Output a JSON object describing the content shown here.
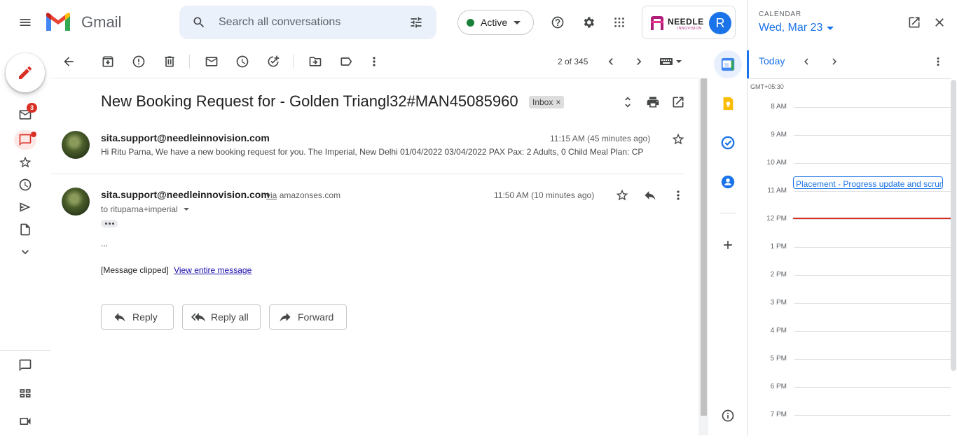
{
  "header": {
    "app_name": "Gmail",
    "search": {
      "placeholder": "Search all conversations"
    },
    "status_label": "Active",
    "brand_name": "NEEDLE",
    "brand_sub": "INNOVISION",
    "account_initial": "R"
  },
  "rail": {
    "mail_badge": "3"
  },
  "toolbar": {
    "pagination": "2 of 345"
  },
  "thread": {
    "subject": "New Booking Request for - Golden Triangl32#MAN45085960",
    "label": "Inbox",
    "messages": [
      {
        "sender": "sita.support@needleinnovision.com",
        "time": "11:15 AM (45 minutes ago)",
        "snippet": "Hi Ritu Parna, We have a new booking request for you. The Imperial, New Delhi 01/04/2022 03/04/2022 PAX Pax: 2 Adults, 0 Child Meal Plan: CP"
      },
      {
        "sender": "sita.support@needleinnovision.com",
        "via": "via",
        "via_domain": "amazonses.com",
        "time": "11:50 AM (10 minutes ago)",
        "to": "to rituparna+imperial",
        "ellipsis": "...",
        "clipped": "[Message clipped]",
        "view_entire": "View entire message"
      }
    ],
    "actions": {
      "reply": "Reply",
      "reply_all": "Reply all",
      "forward": "Forward"
    }
  },
  "calendar": {
    "heading": "CALENDAR",
    "date": "Wed, Mar 23",
    "today": "Today",
    "timezone": "GMT+05:30",
    "hours": [
      "8 AM",
      "9 AM",
      "10 AM",
      "11 AM",
      "12 PM",
      "1 PM",
      "2 PM",
      "3 PM",
      "4 PM",
      "5 PM",
      "6 PM",
      "7 PM"
    ],
    "event": "Placement - Progress update and scrum",
    "now_color": "#d93025",
    "accent": "#1a73e8"
  }
}
